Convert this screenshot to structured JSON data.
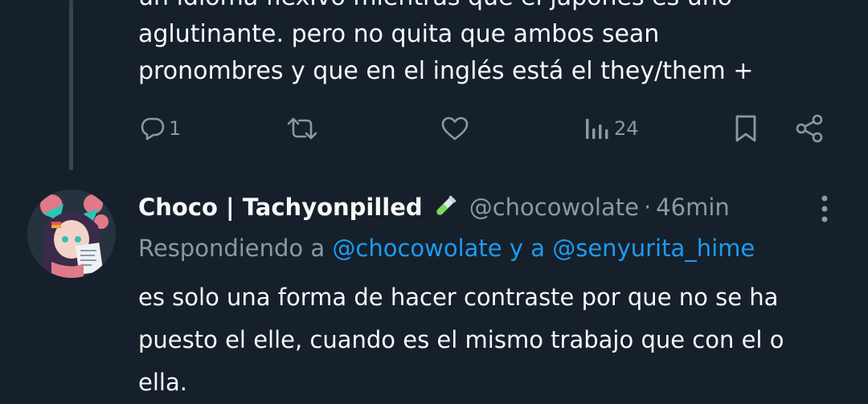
{
  "previous_tweet": {
    "text_line_top": "un idioma flexivo mientras que el japonés es uno",
    "text_lines": [
      "aglutinante. pero no quita que ambos sean",
      "pronombres y que en el inglés está el they/them +"
    ],
    "actions": {
      "reply_count": "1",
      "views_count": "24"
    }
  },
  "reply_tweet": {
    "display_name": "Choco | Tachyonpilled",
    "handle": "@chocowolate",
    "separator": "·",
    "time": "46min",
    "replying_prefix": "Respondiendo a",
    "replying_mention_1": "@chocowolate",
    "replying_joiner": "y a",
    "replying_mention_2": "@senyurita_hime",
    "text_lines": [
      "es solo una forma de hacer contraste por que no se ha",
      "puesto el elle, cuando es el mismo trabajo que con el o",
      "ella."
    ]
  },
  "colors": {
    "background": "#15202b",
    "secondary_text": "#8b98a5",
    "mention": "#1d9bf0",
    "thread_line": "#38444d"
  },
  "icons": [
    "reply-icon",
    "retweet-icon",
    "like-icon",
    "views-icon",
    "bookmark-icon",
    "share-icon",
    "test-tube-icon",
    "more-icon"
  ]
}
